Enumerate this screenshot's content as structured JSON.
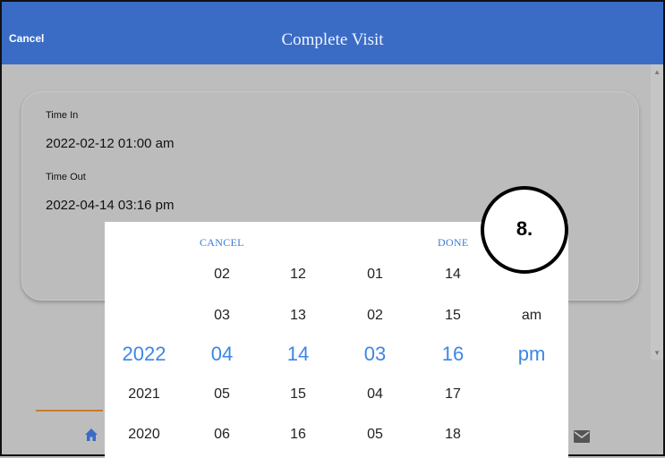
{
  "header": {
    "cancel_label": "Cancel",
    "title": "Complete Visit"
  },
  "card": {
    "time_in_label": "Time In",
    "time_in_value": "2022-02-12 01:00 am",
    "time_out_label": "Time Out",
    "time_out_value": "2022-04-14 03:16 pm"
  },
  "picker": {
    "cancel_label": "CANCEL",
    "done_label": "DONE",
    "year": [
      "",
      "",
      "2022",
      "2021",
      "2020"
    ],
    "month": [
      "02",
      "03",
      "04",
      "05",
      "06"
    ],
    "day": [
      "12",
      "13",
      "14",
      "15",
      "16"
    ],
    "hour": [
      "01",
      "02",
      "03",
      "04",
      "05"
    ],
    "minute": [
      "14",
      "15",
      "16",
      "17",
      "18"
    ],
    "ampm": [
      "",
      "am",
      "pm",
      "",
      ""
    ]
  },
  "badge": {
    "label": "8."
  },
  "colors": {
    "header": "#3a6cc6",
    "accent": "#3d86e6"
  },
  "icons": {
    "home": "home-icon",
    "mail": "mail-icon"
  }
}
